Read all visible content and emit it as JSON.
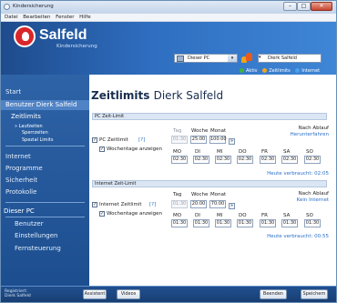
{
  "window": {
    "title": "Kindersicherung",
    "controls": {
      "minimize": "–",
      "maximize": "□",
      "close": "✕"
    }
  },
  "menu": [
    "Datei",
    "Bearbeiten",
    "Fenster",
    "Hilfe"
  ],
  "brand": {
    "name": "Salfeld",
    "subtitle": "Kindersicherung",
    "logo_icon": "salfeld-logo"
  },
  "selectors": {
    "pc": {
      "value": "Dieser PC",
      "arrow": "▾"
    },
    "user": {
      "value": "Dierk Salfeld",
      "arrow": "▾"
    }
  },
  "status_legend": [
    {
      "label": "Aktiv",
      "color": "#3fb43a"
    },
    {
      "label": "Zeitlimits",
      "color": "#f2a51e"
    },
    {
      "label": "Internet",
      "color": "#4aa3e8"
    }
  ],
  "sidebar": {
    "start": "Start",
    "user_item": "Benutzer Dierk Salfeld",
    "zeitlimits": "Zeitlimits",
    "sub": [
      "» Laufzeiten",
      "Sperrzeiten",
      "Spezial Limits"
    ],
    "items": [
      "Internet",
      "Programme",
      "Sicherheit",
      "Protokolle"
    ],
    "pc_header": "Dieser PC",
    "pc_items": [
      "Benutzer",
      "Einstellungen",
      "Fernsteuerung"
    ],
    "registered_line1": "Registriert:",
    "registered_line2": "Dierk Salfeld"
  },
  "main": {
    "title": "Zeitlimits",
    "user": "Dierk Salfeld",
    "pc_section": {
      "header": "PC Zeit-Limit",
      "col_tag": "Tag",
      "col_woche": "Woche",
      "col_monat": "Monat",
      "nach_ablauf": "Nach Ablauf",
      "ablauf_action": "Herunterfahren",
      "checkbox_label": "PC Zeitlimit",
      "help": "[?]",
      "tag_value": "01:30",
      "woche_value": "25:00",
      "monat_value": "100:00",
      "more": "»",
      "wochentage_label": "Wochentage anzeigen",
      "days": [
        "MO",
        "DI",
        "MI",
        "DO",
        "FR",
        "SA",
        "SO"
      ],
      "day_values": [
        "02:30",
        "02:30",
        "02:30",
        "02:30",
        "02:30",
        "02:30",
        "02:30"
      ],
      "heute": "Heute verbraucht: 02:05"
    },
    "internet_section": {
      "header": "Internet Zeit-Limit",
      "col_tag": "Tag",
      "col_woche": "Woche",
      "col_monat": "Monat",
      "nach_ablauf": "Nach Ablauf",
      "ablauf_action": "Kein Internet",
      "checkbox_label": "Internet Zeitlimit",
      "help": "[?]",
      "tag_value": "01:30",
      "woche_value": "20:00",
      "monat_value": "70:00",
      "more": "»",
      "wochentage_label": "Wochentage anzeigen",
      "days": [
        "MO",
        "DI",
        "MI",
        "DO",
        "FR",
        "SA",
        "SO"
      ],
      "day_values": [
        "01:30",
        "01:30",
        "01:30",
        "01:30",
        "01:30",
        "01:30",
        "01:30"
      ],
      "heute": "Heute verbraucht: 00:55"
    }
  },
  "footer": {
    "assistent": "Assistent",
    "videos": "Videos",
    "beenden": "Beenden",
    "speichern": "Speichern"
  }
}
